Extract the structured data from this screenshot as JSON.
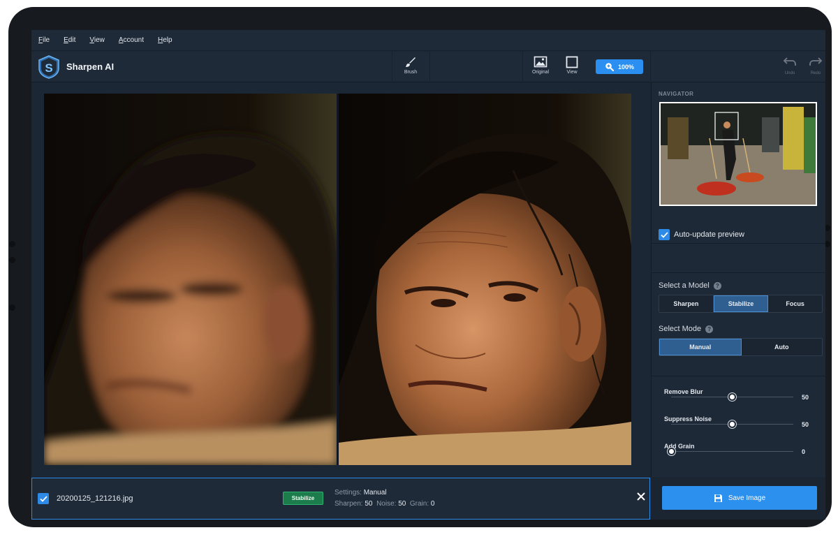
{
  "menu": [
    "File",
    "Edit",
    "View",
    "Account",
    "Help"
  ],
  "app": {
    "title": "Sharpen AI"
  },
  "toolbar": {
    "brush": "Brush",
    "original": "Original",
    "view": "View",
    "zoom": "100%",
    "undo": "Undo",
    "redo": "Redo"
  },
  "navigator": {
    "title": "NAVIGATOR"
  },
  "auto_update": {
    "label": "Auto-update preview",
    "checked": true
  },
  "model": {
    "label": "Select a Model",
    "options": [
      "Sharpen",
      "Stabilize",
      "Focus"
    ],
    "selected": "Stabilize"
  },
  "mode": {
    "label": "Select Mode",
    "options": [
      "Manual",
      "Auto"
    ],
    "selected": "Manual"
  },
  "sliders": [
    {
      "label": "Remove Blur",
      "value": 50,
      "max": 100
    },
    {
      "label": "Suppress Noise",
      "value": 50,
      "max": 100
    },
    {
      "label": "Add Grain",
      "value": 0,
      "max": 100
    }
  ],
  "file": {
    "name": "20200125_121216.jpg",
    "badge": "Stabilize",
    "settings_label": "Settings:",
    "settings_value": "Manual",
    "sharpen_label": "Sharpen:",
    "sharpen_value": "50",
    "noise_label": "Noise:",
    "noise_value": "50",
    "grain_label": "Grain:",
    "grain_value": "0"
  },
  "save": {
    "label": "Save Image"
  },
  "colors": {
    "accent": "#2b90ee",
    "panel": "#1e2937",
    "badge": "#1d7c4c"
  }
}
